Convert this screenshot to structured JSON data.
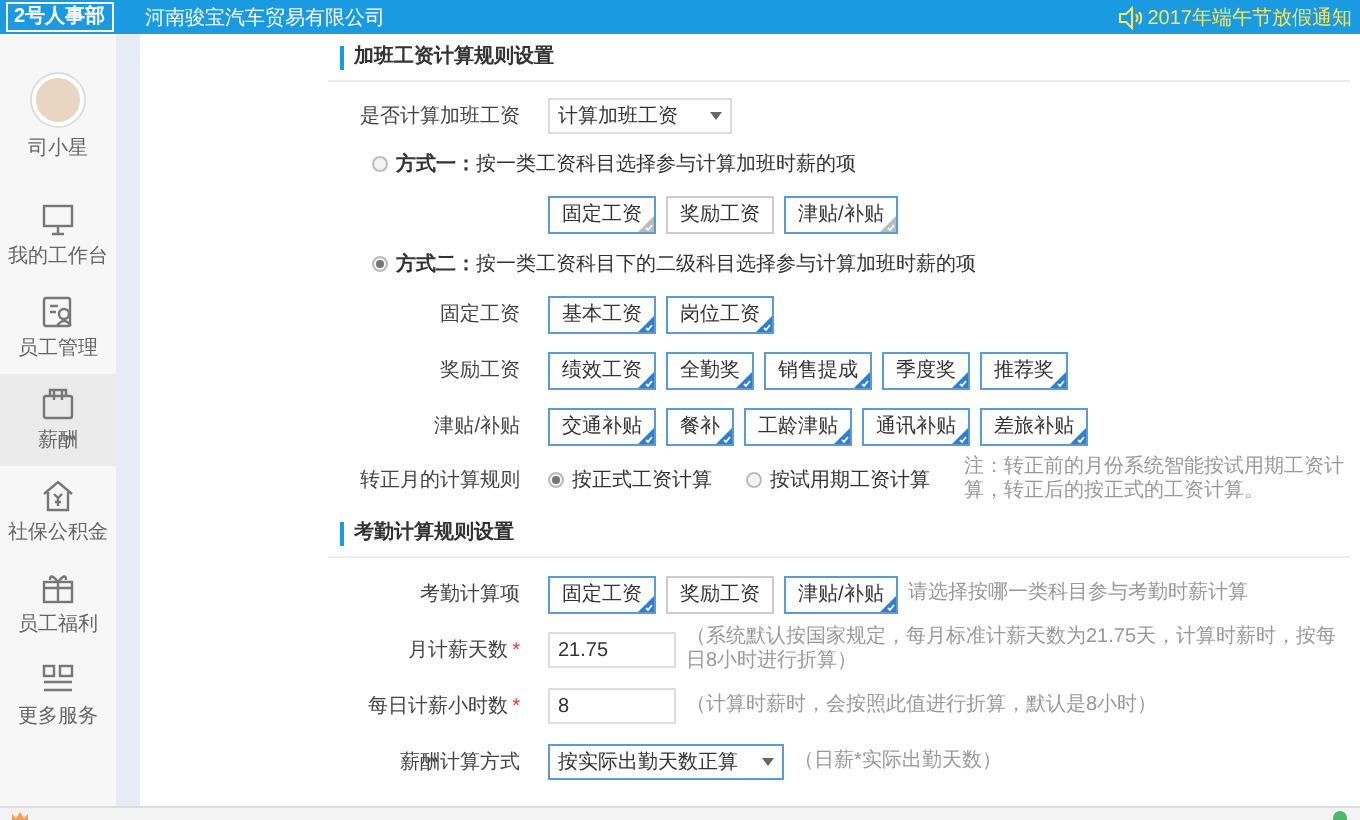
{
  "header": {
    "logo": "2号人事部",
    "company": "河南骏宝汽车贸易有限公司",
    "notice": "2017年端午节放假通知"
  },
  "sidebar": {
    "user": {
      "name": "司小星"
    },
    "items": [
      {
        "label": "我的工作台",
        "selected": false
      },
      {
        "label": "员工管理",
        "selected": false
      },
      {
        "label": "薪酬",
        "selected": true
      },
      {
        "label": "社保公积金",
        "selected": false
      },
      {
        "label": "员工福利",
        "selected": false
      },
      {
        "label": "更多服务",
        "selected": false
      }
    ]
  },
  "overtime": {
    "title": "加班工资计算规则设置",
    "calc_label": "是否计算加班工资",
    "calc_select": "计算加班工资",
    "methods": [
      {
        "label": "**方式一：**按一类工资科目选择参与计算加班时薪的项",
        "selected": false,
        "groups": [
          {
            "chips": [
              {
                "label": "固定工资",
                "selected": true
              },
              {
                "label": "奖励工资",
                "selected": false
              },
              {
                "label": "津贴/补贴",
                "selected": true
              }
            ]
          }
        ]
      },
      {
        "label": "**方式二：**按一类工资科目下的二级科目选择参与计算加班时薪的项",
        "selected": true,
        "groups": [
          {
            "label": "固定工资",
            "chips": [
              {
                "label": "基本工资",
                "selected": true
              },
              {
                "label": "岗位工资",
                "selected": true
              }
            ]
          },
          {
            "label": "奖励工资",
            "chips": [
              {
                "label": "绩效工资",
                "selected": true
              },
              {
                "label": "全勤奖",
                "selected": true
              },
              {
                "label": "销售提成",
                "selected": true
              },
              {
                "label": "季度奖",
                "selected": true
              },
              {
                "label": "推荐奖",
                "selected": true
              }
            ]
          },
          {
            "label": "津贴/补贴",
            "chips": [
              {
                "label": "交通补贴",
                "selected": true
              },
              {
                "label": "餐补",
                "selected": true
              },
              {
                "label": "工龄津贴",
                "selected": true
              },
              {
                "label": "通讯补贴",
                "selected": true
              },
              {
                "label": "差旅补贴",
                "selected": true
              }
            ]
          }
        ]
      }
    ],
    "transfer_rule": {
      "label": "转正月的计算规则",
      "options": [
        {
          "label": "按正式工资计算",
          "selected": true
        },
        {
          "label": "按试用期工资计算",
          "selected": false
        }
      ],
      "note": "注：转正前的月份系统智能按试用期工资计算，转正后的按正式的工资计算。"
    }
  },
  "attendance": {
    "title": "考勤计算规则设置",
    "rows": [
      {
        "kind": "chips",
        "label": "考勤计算项",
        "chips": [
          {
            "label": "固定工资",
            "selected": true
          },
          {
            "label": "奖励工资",
            "selected": false
          },
          {
            "label": "津贴/补贴",
            "selected": true
          }
        ],
        "hint": "请选择按哪一类科目参与考勤时薪计算"
      },
      {
        "kind": "input",
        "label": "月计薪天数",
        "required_mark": "*",
        "value": "21.75",
        "hint": "（系统默认按国家规定，每月标准计薪天数为21.75天，计算时薪时，按每日8小时进行折算）"
      },
      {
        "kind": "input",
        "label": "每日计薪小时数",
        "required_mark": "*",
        "value": "8",
        "hint": "（计算时薪时，会按照此值进行折算，默认是8小时）"
      },
      {
        "kind": "select",
        "label": "薪酬计算方式",
        "value": "按实际出勤天数正算",
        "hint": "（日薪*实际出勤天数）"
      }
    ]
  }
}
